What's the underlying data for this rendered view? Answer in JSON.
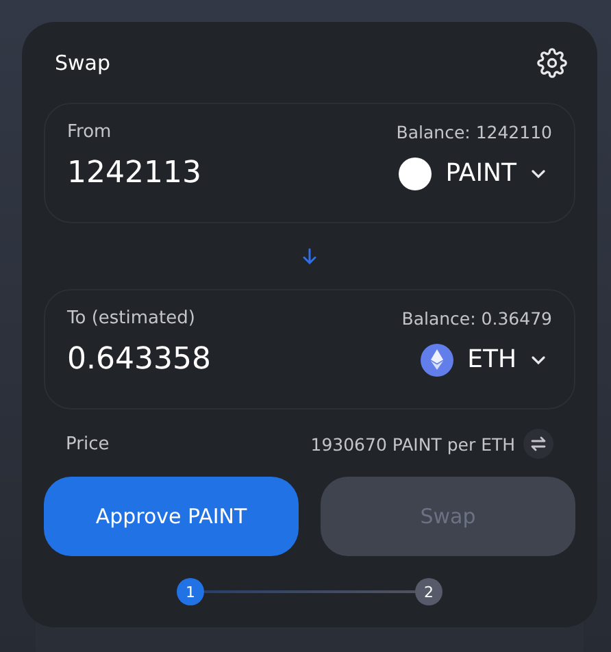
{
  "title": "Swap",
  "panels": [
    {
      "label": "From",
      "balance": "Balance: 1242110",
      "amount": "1242113",
      "token": {
        "symbol": "PAINT",
        "kind": "plain"
      }
    },
    {
      "label": "To (estimated)",
      "balance": "Balance: 0.36479",
      "amount": "0.643358",
      "token": {
        "symbol": "ETH",
        "kind": "eth"
      }
    }
  ],
  "price": {
    "label": "Price",
    "value": "1930670 PAINT per ETH"
  },
  "buttons": [
    {
      "label": "Approve PAINT",
      "disabled": false
    },
    {
      "label": "Swap",
      "disabled": true
    }
  ],
  "steps": [
    {
      "label": "1",
      "selected": true
    },
    {
      "label": "2",
      "selected": false
    }
  ]
}
